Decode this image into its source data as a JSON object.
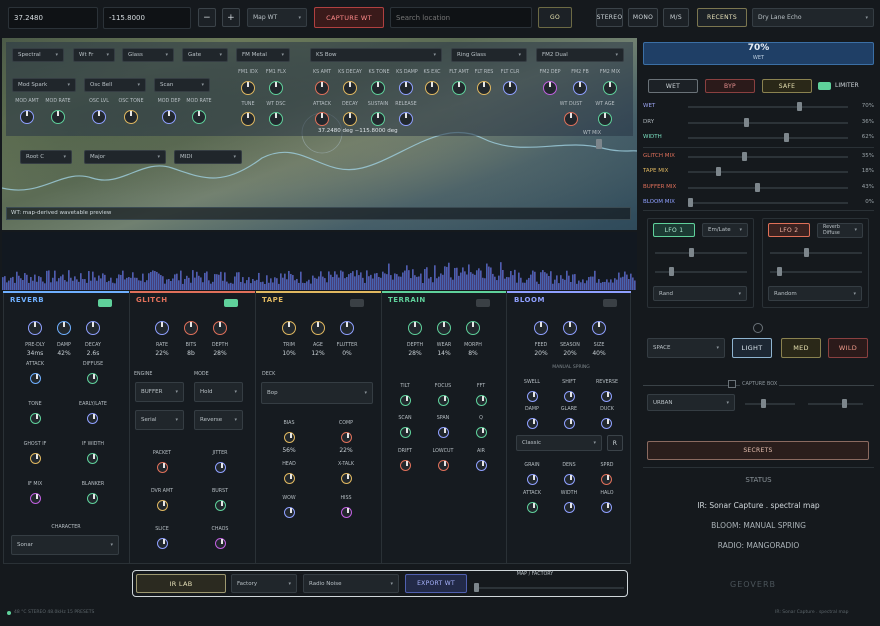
{
  "toolbar": {
    "lat": "37.2480",
    "lon": "-115.8000",
    "minus": "−",
    "plus": "+",
    "map_select": "Map WT",
    "capture": "CAPTURE WT",
    "search_placeholder": "Search location",
    "go": "GO",
    "stereo": "STEREO",
    "mono": "MONO",
    "ms": "M/S",
    "recents": "RECENTS",
    "preset": "Dry Lane Echo"
  },
  "synth": {
    "row1": [
      "Spectral",
      "Wt Fr",
      "Glass",
      "Gate",
      "FM Metal"
    ],
    "ks_select": "KS Bow",
    "ring": "Ring Glass",
    "fm2": "FM2 Dual",
    "row2": [
      "Mod Spark",
      "Osc Bell",
      "Scan"
    ],
    "fm_labels": [
      "FM1 IDX",
      "FM1 FLX",
      "KS AMT",
      "KS DECAY",
      "KS TONE",
      "KS DAMP",
      "KS EXC",
      "FLT AMT",
      "FLT RES",
      "FLT CLR",
      "FM2 DEP",
      "FM2 FB",
      "FM2 MIX"
    ],
    "mod_labels": [
      "MOD AMT",
      "MOD RATE",
      "OSC LVL",
      "OSC TONE",
      "MOD DEP",
      "MOD RATE"
    ],
    "tune_labels": [
      "TUNE",
      "WT DSC",
      "ATTACK",
      "DECAY",
      "SUSTAIN",
      "RELEASE",
      "WT DUST",
      "WT AGE"
    ],
    "wt_mix": "WT MIX",
    "coords": "37.2480 deg −115.8000 deg",
    "row3": [
      "Root C",
      "Major",
      "MIDI"
    ],
    "preview": "WT: map-derived wavetable preview"
  },
  "right": {
    "wet_pct": "70%",
    "wet_label": "WET",
    "wet_btn": "WET",
    "byp_btn": "BYP",
    "safe_btn": "SAFE",
    "limiter": "LIMITER",
    "sliders": [
      {
        "name": "WET",
        "pct": "70%",
        "level": 0.7,
        "color": "#9aa3f0"
      },
      {
        "name": "DRY",
        "pct": "36%",
        "level": 0.36,
        "color": "#aeb6bb"
      },
      {
        "name": "WIDTH",
        "pct": "62%",
        "level": 0.62,
        "color": "#7be0c0"
      },
      {
        "name": "GLITCH MIX",
        "pct": "35%",
        "level": 0.35,
        "color": "#e0705a"
      },
      {
        "name": "TAPE MIX",
        "pct": "18%",
        "level": 0.18,
        "color": "#e0b860"
      },
      {
        "name": "BUFFER MIX",
        "pct": "43%",
        "level": 0.43,
        "color": "#e0705a"
      },
      {
        "name": "BLOOM MIX",
        "pct": "0%",
        "level": 0.0,
        "color": "#8fa0ff"
      }
    ],
    "lfo1": "LFO 1",
    "lfo1_sel": "Em/Late",
    "lfo1_mode": "Rand",
    "lfo2": "LFO 2",
    "lfo2_sel": "Reverb Diffuse",
    "lfo2_mode": "Random",
    "space": "SPACE",
    "light": "LIGHT",
    "med": "MED",
    "wild": "WILD",
    "capture_box": "CAPTURE BOX",
    "urban": "URBAN",
    "secrets": "SECRETS",
    "status_title": "STATUS",
    "status1": "IR: Sonar Capture . spectral map",
    "status2": "BLOOM: MANUAL SPRING",
    "status3": "RADIO: MANGORADIO"
  },
  "fx": {
    "reverb": {
      "title": "REVERB",
      "color": "#6fb0ff",
      "k": [
        "PRE-DLY",
        "DAMP",
        "DECAY"
      ],
      "v": [
        "34ms",
        "42%",
        "2.6s"
      ],
      "labels": [
        "ATTACK",
        "DIFFUSE",
        "TONE",
        "EARLY/LATE",
        "GHOST IF",
        "IF WIDTH",
        "IF MIX",
        "BLANKER"
      ],
      "character": "CHARACTER",
      "char_sel": "Sonar"
    },
    "glitch": {
      "title": "GLITCH",
      "color": "#e0705a",
      "k": [
        "RATE",
        "BITS",
        "DEPTH"
      ],
      "v": [
        "22%",
        "8b",
        "28%"
      ],
      "engine": "ENGINE",
      "mode": "MODE",
      "s1": "BUFFER",
      "s2": "Hold",
      "s3": "Serial",
      "s4": "Reverse",
      "labels": [
        "PACKET",
        "JITTER",
        "DVR AMT",
        "BURST",
        "SLICE",
        "CHAOS"
      ]
    },
    "tape": {
      "title": "TAPE",
      "color": "#e0b860",
      "k": [
        "TRIM",
        "AGE",
        "FLUTTER"
      ],
      "v": [
        "10%",
        "12%",
        "0%"
      ],
      "deck": "DECK",
      "deck_sel": "Bop",
      "labels": [
        "BIAS",
        "COMP",
        "HEAD",
        "X-TALK",
        "WOW",
        "HISS"
      ],
      "v2": [
        "56%",
        "22%"
      ]
    },
    "terrain": {
      "title": "TERRAIN",
      "color": "#5fd19b",
      "k": [
        "DEPTH",
        "WEAR",
        "MORPH"
      ],
      "v": [
        "28%",
        "14%",
        "8%"
      ],
      "labels": [
        "TILT",
        "FOCUS",
        "FFT",
        "SCAN",
        "SPAN",
        "Q",
        "DRIFT",
        "LOWCUT",
        "AIR"
      ]
    },
    "bloom": {
      "title": "BLOOM",
      "color": "#8fa0ff",
      "k": [
        "FEED",
        "SEASON",
        "SIZE"
      ],
      "v": [
        "20%",
        "20%",
        "40%"
      ],
      "manual": "MANUAL SPRING",
      "labels": [
        "SWELL",
        "SHIFT",
        "REVERSE",
        "DAMP",
        "GLARE",
        "DUCK",
        "GRAIN",
        "DENS",
        "SPRD",
        "ATTACK",
        "WIDTH",
        "HALO"
      ],
      "classic": "Classic",
      "r": "R"
    }
  },
  "bottom": {
    "irlab": "IR LAB",
    "factory": "Factory",
    "radio": "Radio Noise",
    "export": "EXPORT WT",
    "mapfac": "MAP / FACTORY",
    "brand": "GEOVERB"
  },
  "footer": {
    "left": "48 °C   STEREO   48.0kHz   15 PRESETS",
    "right": "IR: Sonar Capture . spectral map"
  }
}
